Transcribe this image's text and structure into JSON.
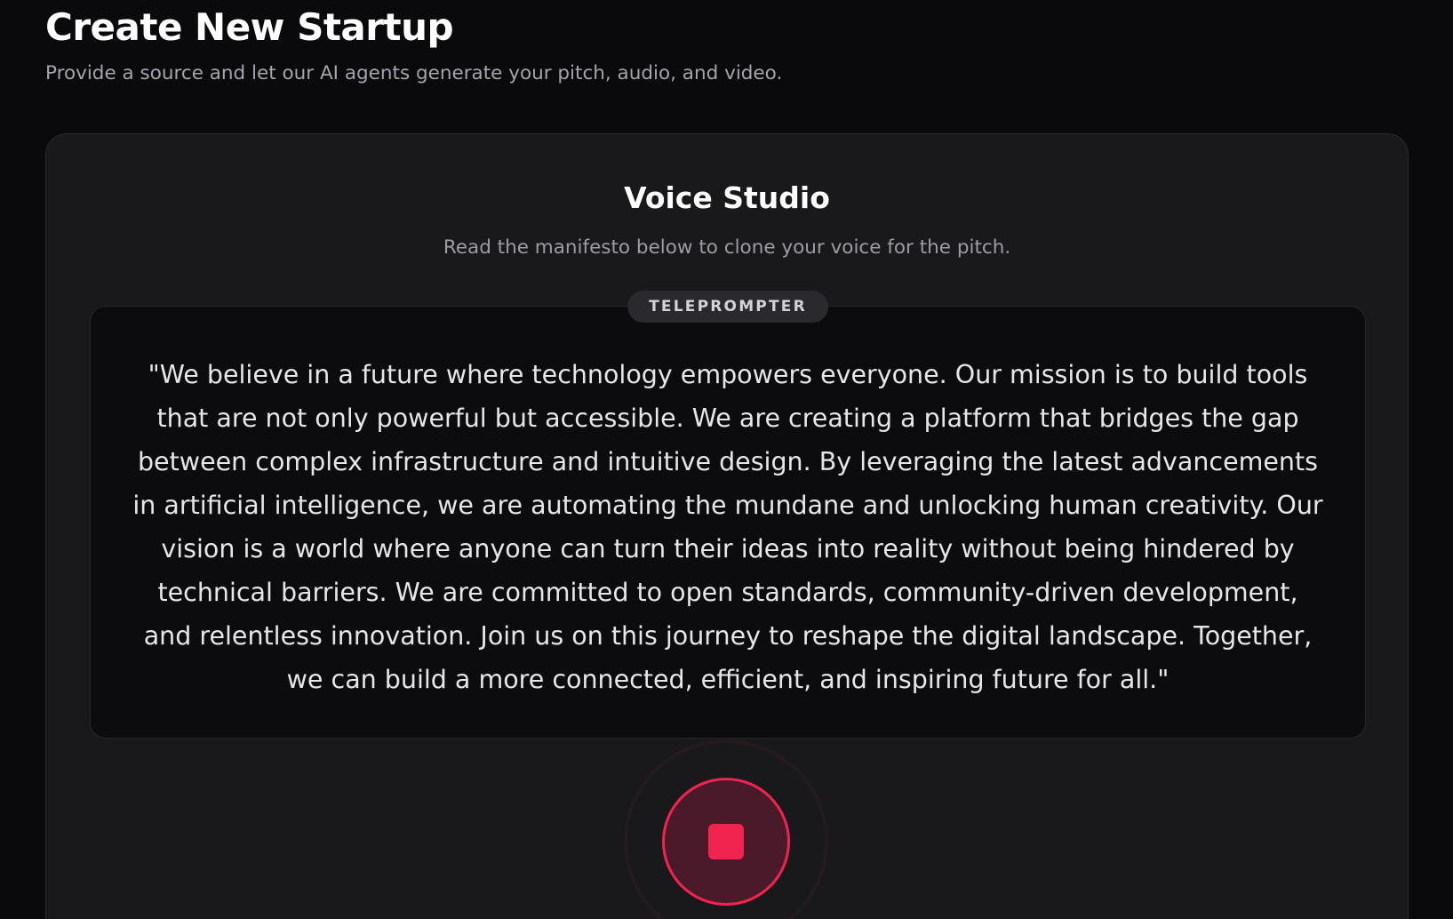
{
  "header": {
    "title": "Create New Startup",
    "subtitle": "Provide a source and let our AI agents generate your pitch, audio, and video."
  },
  "voice_studio": {
    "title": "Voice Studio",
    "subtitle": "Read the manifesto below to clone your voice for the pitch.",
    "teleprompter": {
      "badge": "TELEPROMPTER",
      "text": "\"We believe in a future where technology empowers everyone. Our mission is to build tools that are not only powerful but accessible. We are creating a platform that bridges the gap between complex infrastructure and intuitive design. By leveraging the latest advancements in artificial intelligence, we are automating the mundane and unlocking human creativity. Our vision is a world where anyone can turn their ideas into reality without being hindered by technical barriers. We are committed to open standards, community-driven development, and relentless innovation. Join us on this journey to reshape the digital landscape. Together, we can build a more connected, efficient, and inspiring future for all.\""
    },
    "record_button": {
      "state": "recording",
      "icon": "stop-icon",
      "accent_color": "#f0244f"
    }
  }
}
